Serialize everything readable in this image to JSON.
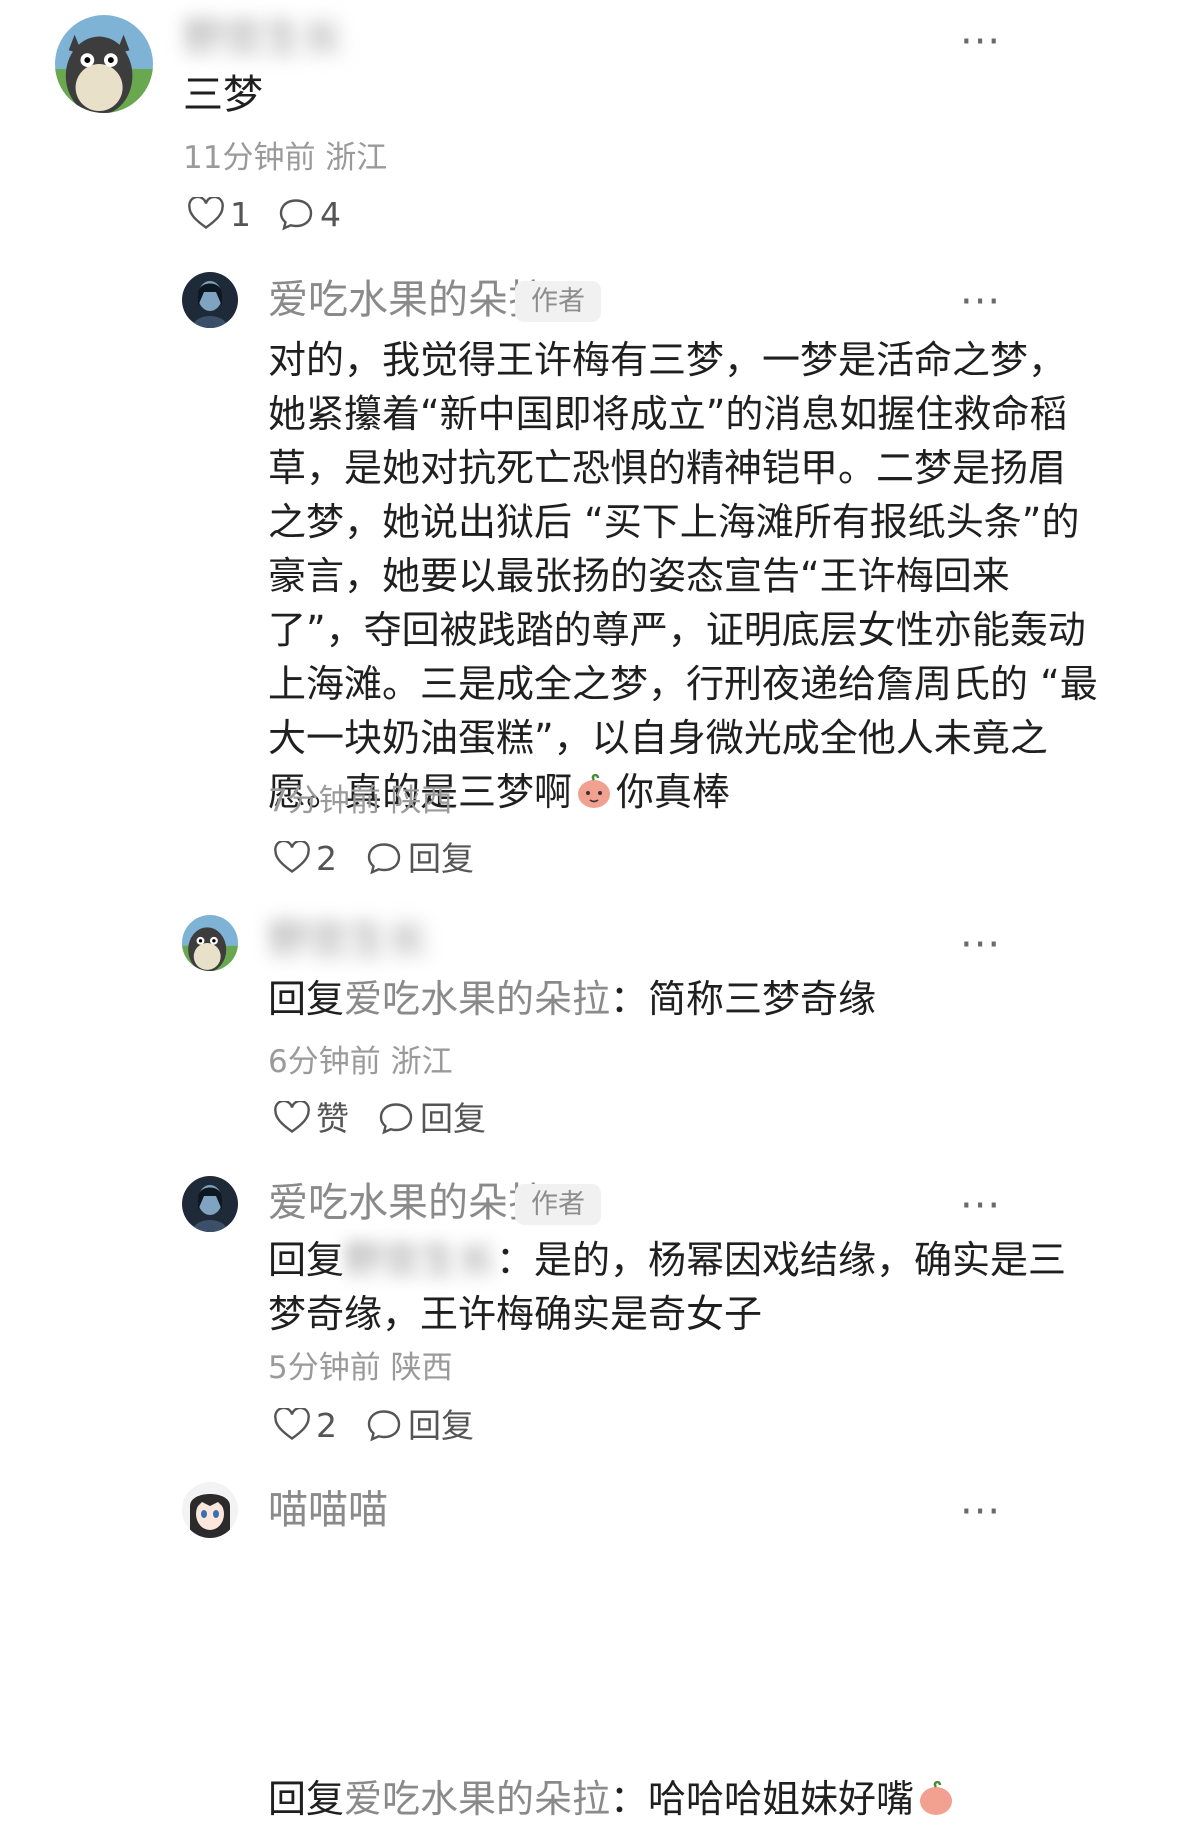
{
  "comment1": {
    "username": "野宫生长",
    "text": "三梦",
    "meta": "11分钟前 浙江",
    "likes": "1",
    "replies_count": "4",
    "more": "···"
  },
  "reply1": {
    "username": "爱吃水果的朵拉",
    "badge": "作者",
    "lines": [
      "对的，我觉得王许梅有三梦，一梦是活命之梦，",
      "她紧攥着“新中国即将成立”的消息如握住救命稻",
      "草，是她对抗死亡恐惧的精神铠甲。二梦是扬眉",
      "之梦，她说出狱后 “买下上海滩所有报纸头条”的",
      "豪言，她要以最张扬的姿态宣告“王许梅回来",
      "了”，夺回被践踏的尊严，证明底层女性亦能轰动",
      "上海滩。三是成全之梦，行刑夜递给詹周氏的 “最",
      "大一块奶油蛋糕”，以自身微光成全他人未竟之"
    ],
    "last_line_a": "愿。真的是三梦啊",
    "last_line_b": "你真棒",
    "meta": "7分钟前 陕西",
    "likes": "2",
    "reply_label": "回复",
    "more": "···"
  },
  "reply2": {
    "username": "野宫生长",
    "reply_prefix": "回复",
    "reply_target": "爱吃水果的朵拉",
    "text": "：简称三梦奇缘",
    "meta": "6分钟前 浙江",
    "like_label": "赞",
    "reply_label": "回复",
    "more": "···"
  },
  "reply3": {
    "username": "爱吃水果的朵拉",
    "badge": "作者",
    "reply_prefix": "回复",
    "reply_target": "野宫生长",
    "text_line1": "：是的，杨幂因戏结缘，确实是三",
    "text_line2": "梦奇缘，王许梅确实是奇女子",
    "meta": "5分钟前 陕西",
    "likes": "2",
    "reply_label": "回复",
    "more": "···"
  },
  "reply4": {
    "username": "喵喵喵",
    "reply_prefix": "回复",
    "reply_target": "爱吃水果的朵拉",
    "text": "：哈哈哈姐妹好嘴",
    "more": "···"
  },
  "colors": {
    "text": "#1f1f1f",
    "secondary": "#8a8a8a",
    "meta": "#9a9a9a",
    "badge_bg": "#f1f1f1"
  }
}
